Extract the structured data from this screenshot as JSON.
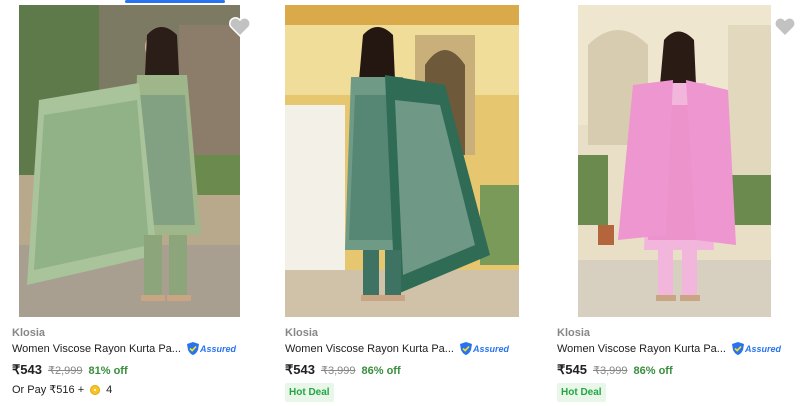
{
  "products": [
    {
      "brand": "Klosia",
      "title": "Women Viscose Rayon Kurta Pa...",
      "assured_label": "Assured",
      "price": "₹543",
      "mrp": "₹2,999",
      "discount": "81% off",
      "pay_text": "Or Pay ₹516 +",
      "coins": "4",
      "image_icon": "kurta-set-green-ikat-image",
      "wishlist_icon": "heart-icon"
    },
    {
      "brand": "Klosia",
      "title": "Women Viscose Rayon Kurta Pa...",
      "assured_label": "Assured",
      "price": "₹543",
      "mrp": "₹3,999",
      "discount": "86% off",
      "badge": "Hot Deal",
      "image_icon": "kurta-set-teal-print-image"
    },
    {
      "brand": "Klosia",
      "title": "Women Viscose Rayon Kurta Pa...",
      "assured_label": "Assured",
      "price": "₹545",
      "mrp": "₹3,999",
      "discount": "86% off",
      "badge": "Hot Deal",
      "image_icon": "kurta-set-pink-floral-image",
      "wishlist_icon": "heart-icon"
    }
  ],
  "colors": {
    "accent": "#2874f0",
    "discount": "#388e3c",
    "hot_deal_bg": "#e8f7ea",
    "hot_deal_text": "#26a541"
  }
}
